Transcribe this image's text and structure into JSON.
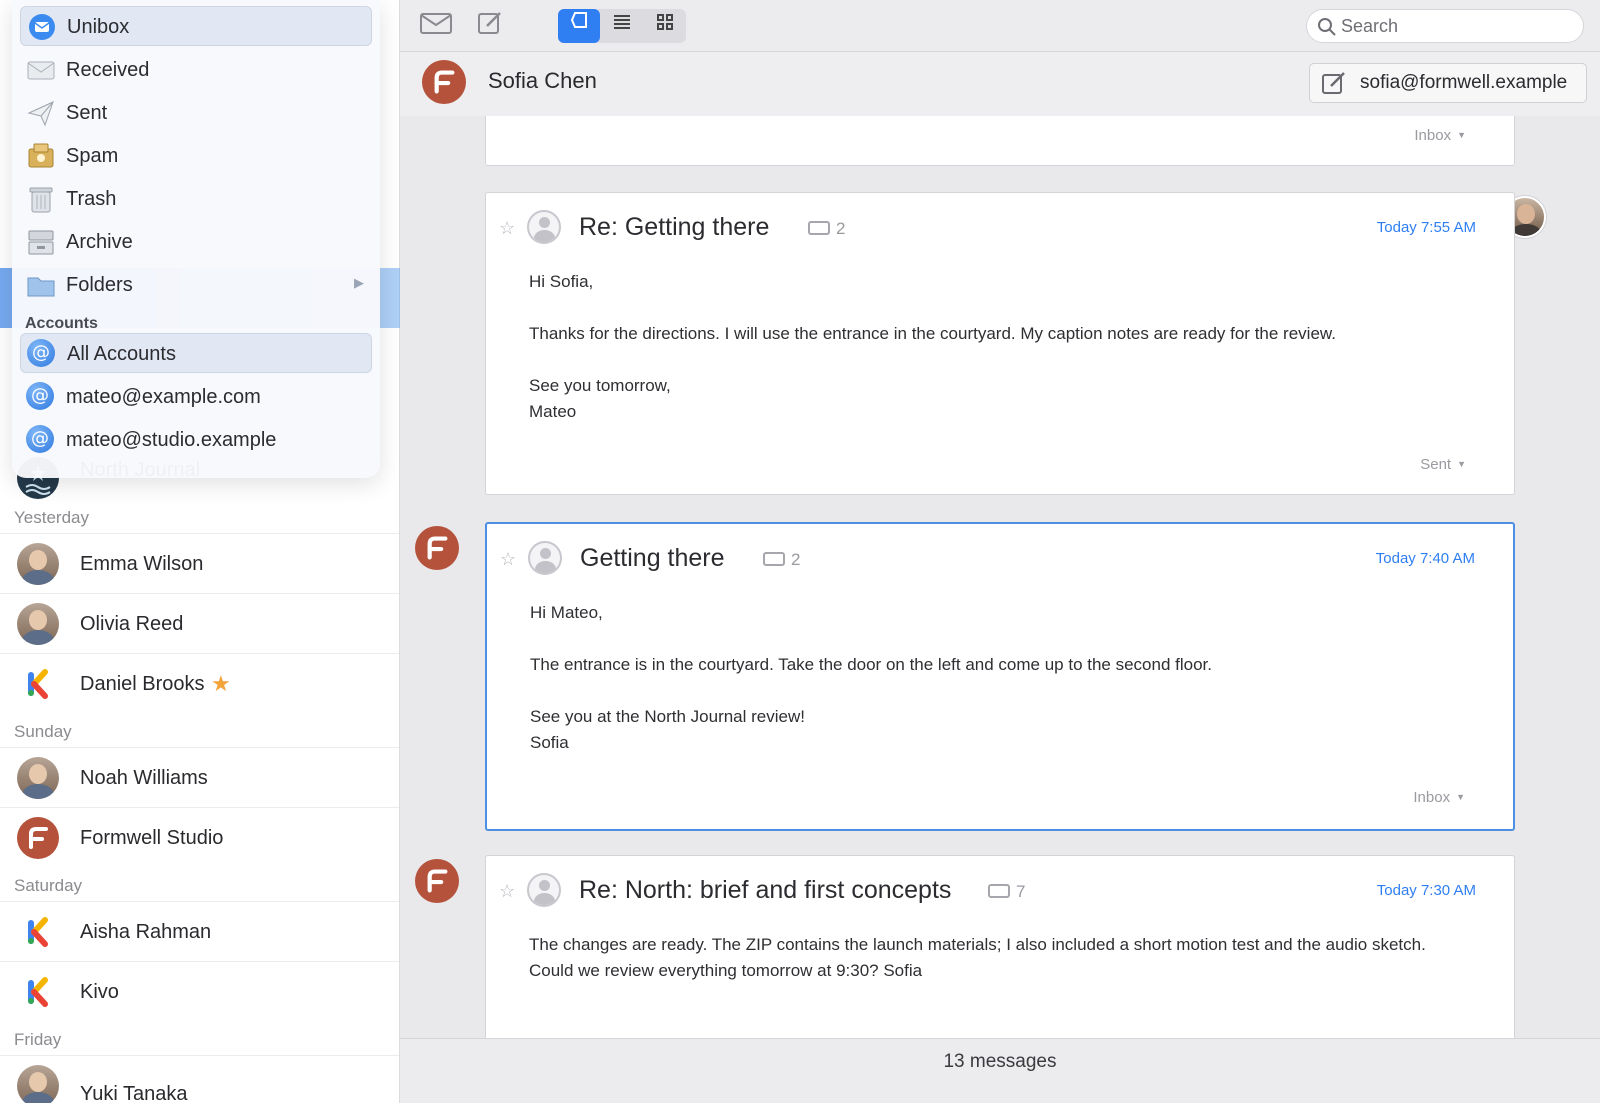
{
  "toolbar": {
    "search_placeholder": "Search"
  },
  "thread": {
    "name": "Sofia Chen",
    "reply_to": "sofia@formwell.example"
  },
  "menu": {
    "mailboxes": [
      {
        "label": "Unibox",
        "icon": "unibox-icon"
      },
      {
        "label": "Received",
        "icon": "received-icon"
      },
      {
        "label": "Sent",
        "icon": "sent-icon"
      },
      {
        "label": "Spam",
        "icon": "spam-icon"
      },
      {
        "label": "Trash",
        "icon": "trash-icon"
      },
      {
        "label": "Archive",
        "icon": "archive-icon"
      },
      {
        "label": "Folders",
        "icon": "folder-icon"
      }
    ],
    "accounts_header": "Accounts",
    "accounts": [
      {
        "label": "All Accounts"
      },
      {
        "label": "mateo@example.com"
      },
      {
        "label": "mateo@studio.example"
      }
    ]
  },
  "sidebar": {
    "partial_item": "North Journal",
    "groups": [
      {
        "header": "Yesterday",
        "contacts": [
          "Emma Wilson",
          "Olivia Reed",
          "Daniel Brooks"
        ]
      },
      {
        "header": "Sunday",
        "contacts": [
          "Noah Williams",
          "Formwell Studio"
        ]
      },
      {
        "header": "Saturday",
        "contacts": [
          "Aisha Rahman",
          "Kivo"
        ]
      },
      {
        "header": "Friday",
        "contacts": [
          "Yuki Tanaka"
        ]
      }
    ]
  },
  "messages": [
    {
      "folder": "Inbox"
    },
    {
      "subject": "Re: Getting there",
      "thread_count": "2",
      "time": "Today 7:55 AM",
      "body": [
        "Hi Sofia,",
        "Thanks for the directions. I will use the entrance in the courtyard. My caption notes are ready for the review.",
        "See you tomorrow,",
        "Mateo"
      ],
      "folder": "Sent"
    },
    {
      "subject": "Getting there",
      "thread_count": "2",
      "time": "Today 7:40 AM",
      "body": [
        "Hi Mateo,",
        "The entrance is in the courtyard. Take the door on the left and come up to the second floor.",
        "See you at the North Journal review!",
        "Sofia"
      ],
      "folder": "Inbox"
    },
    {
      "subject": "Re: North: brief and first concepts",
      "thread_count": "7",
      "time": "Today 7:30 AM",
      "body": [
        "The changes are ready. The ZIP contains the launch materials; I also included a short motion test and the audio sketch. Could we review everything tomorrow at 9:30? Sofia"
      ]
    }
  ],
  "status": {
    "count_text": "13 messages"
  },
  "colors": {
    "accent": "#2f7ff2",
    "formwell_brand": "#b5523b",
    "star": "#f2a33a"
  }
}
